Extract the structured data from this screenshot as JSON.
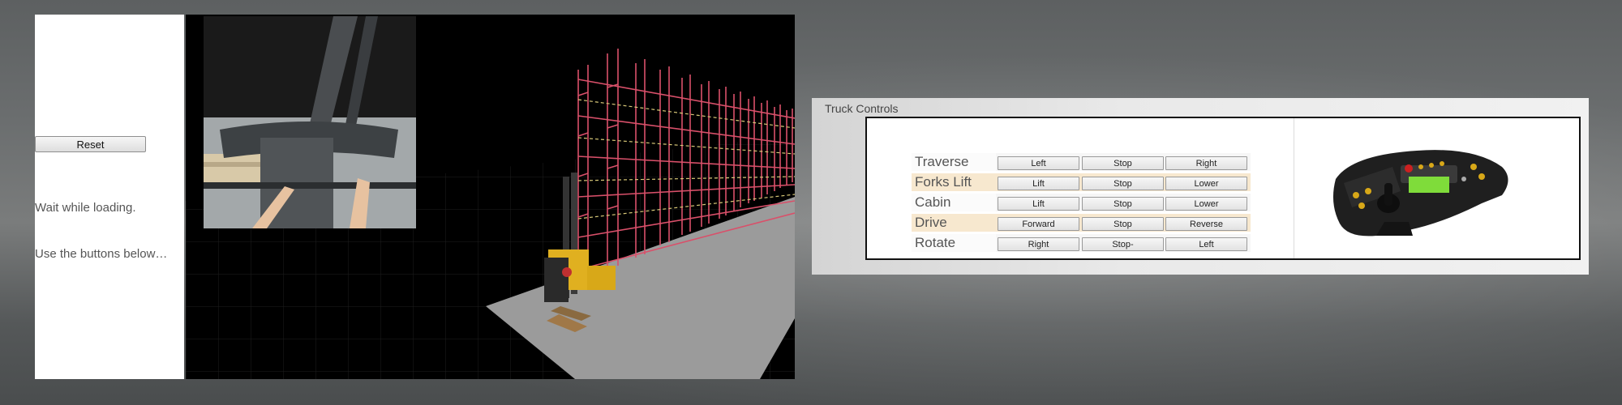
{
  "sidebar": {
    "reset_label": "Reset",
    "status": "Wait while loading.",
    "hint": "Use the buttons below…"
  },
  "viewport": {
    "scene": "forklift-warehouse-3d",
    "inset": "cab-first-person-view"
  },
  "controls": {
    "title": "Truck Controls",
    "rows": [
      {
        "label": "Traverse",
        "buttons": [
          "Left",
          "Stop",
          "Right"
        ]
      },
      {
        "label": "Forks Lift",
        "buttons": [
          "Lift",
          "Stop",
          "Lower"
        ]
      },
      {
        "label": "Cabin",
        "buttons": [
          "Lift",
          "Stop",
          "Lower"
        ]
      },
      {
        "label": "Drive",
        "buttons": [
          "Forward",
          "Stop",
          "Reverse"
        ]
      },
      {
        "label": "Rotate",
        "buttons": [
          "Right",
          "Stop-",
          "Left"
        ]
      }
    ],
    "controller_icon": "joystick-controller-icon"
  },
  "colors": {
    "rack": "#d9506a",
    "beam": "#d8c878",
    "shaded_row": "#f7e8cf",
    "floor": "#9a9a9a",
    "forklift": "#e0b020"
  }
}
